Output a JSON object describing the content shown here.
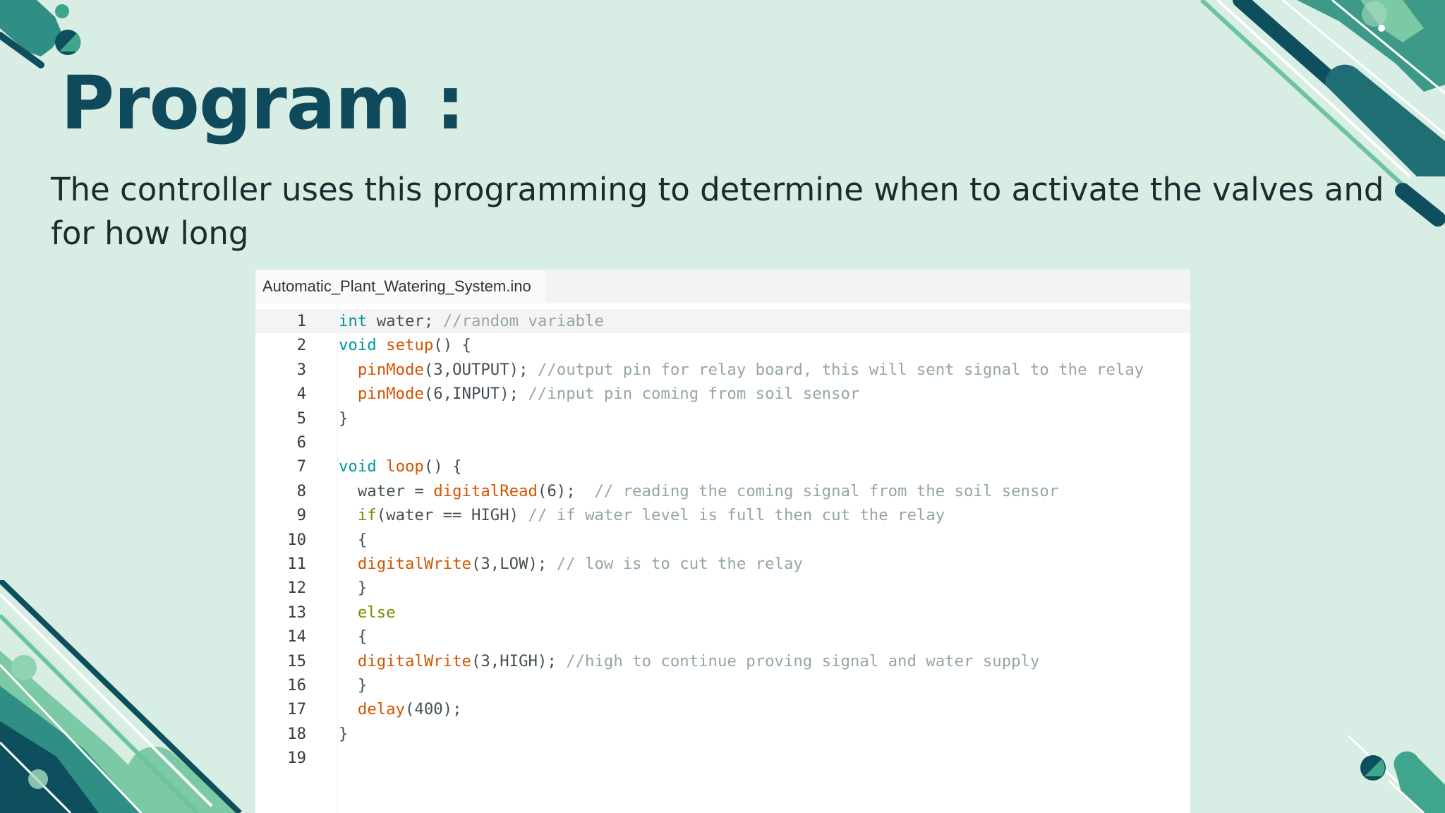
{
  "slide": {
    "title": "Program :",
    "description": "The controller uses this programming to determine when to activate the valves and for how long"
  },
  "colors": {
    "background": "#d8ede4",
    "title": "#0f4a5c",
    "deco_dark": "#0d4f5c",
    "deco_mid": "#2f8f84",
    "deco_light": "#7cc9a6",
    "syntax_type": "#00979c",
    "syntax_function": "#d35400",
    "syntax_keyword": "#728e00",
    "syntax_comment": "#95a5a6"
  },
  "editor": {
    "tab_label": "Automatic_Plant_Watering_System.ino",
    "active_line": 1,
    "lines": [
      {
        "n": "1",
        "tokens": [
          [
            "type",
            "int"
          ],
          [
            "txt",
            " water; "
          ],
          [
            "cmt",
            "//random variable"
          ]
        ]
      },
      {
        "n": "2",
        "tokens": [
          [
            "type",
            "void"
          ],
          [
            "txt",
            " "
          ],
          [
            "fn",
            "setup"
          ],
          [
            "txt",
            "() {"
          ]
        ]
      },
      {
        "n": "3",
        "tokens": [
          [
            "txt",
            "  "
          ],
          [
            "fn",
            "pinMode"
          ],
          [
            "txt",
            "(3,OUTPUT); "
          ],
          [
            "cmt",
            "//output pin for relay board, this will sent signal to the relay"
          ]
        ]
      },
      {
        "n": "4",
        "tokens": [
          [
            "txt",
            "  "
          ],
          [
            "fn",
            "pinMode"
          ],
          [
            "txt",
            "(6,INPUT); "
          ],
          [
            "cmt",
            "//input pin coming from soil sensor"
          ]
        ]
      },
      {
        "n": "5",
        "tokens": [
          [
            "txt",
            "}"
          ]
        ]
      },
      {
        "n": "6",
        "tokens": []
      },
      {
        "n": "7",
        "tokens": [
          [
            "type",
            "void"
          ],
          [
            "txt",
            " "
          ],
          [
            "fn",
            "loop"
          ],
          [
            "txt",
            "() {"
          ]
        ]
      },
      {
        "n": "8",
        "tokens": [
          [
            "txt",
            "  water = "
          ],
          [
            "fn",
            "digitalRead"
          ],
          [
            "txt",
            "(6);  "
          ],
          [
            "cmt",
            "// reading the coming signal from the soil sensor"
          ]
        ]
      },
      {
        "n": "9",
        "tokens": [
          [
            "txt",
            "  "
          ],
          [
            "kw",
            "if"
          ],
          [
            "txt",
            "(water == HIGH) "
          ],
          [
            "cmt",
            "// if water level is full then cut the relay"
          ]
        ]
      },
      {
        "n": "10",
        "tokens": [
          [
            "txt",
            "  {"
          ]
        ]
      },
      {
        "n": "11",
        "tokens": [
          [
            "txt",
            "  "
          ],
          [
            "fn",
            "digitalWrite"
          ],
          [
            "txt",
            "(3,LOW); "
          ],
          [
            "cmt",
            "// low is to cut the relay"
          ]
        ]
      },
      {
        "n": "12",
        "tokens": [
          [
            "txt",
            "  }"
          ]
        ]
      },
      {
        "n": "13",
        "tokens": [
          [
            "txt",
            "  "
          ],
          [
            "kw",
            "else"
          ]
        ]
      },
      {
        "n": "14",
        "tokens": [
          [
            "txt",
            "  {"
          ]
        ]
      },
      {
        "n": "15",
        "tokens": [
          [
            "txt",
            "  "
          ],
          [
            "fn",
            "digitalWrite"
          ],
          [
            "txt",
            "(3,HIGH); "
          ],
          [
            "cmt",
            "//high to continue proving signal and water supply"
          ]
        ]
      },
      {
        "n": "16",
        "tokens": [
          [
            "txt",
            "  }"
          ]
        ]
      },
      {
        "n": "17",
        "tokens": [
          [
            "txt",
            "  "
          ],
          [
            "fn",
            "delay"
          ],
          [
            "txt",
            "(400);"
          ]
        ]
      },
      {
        "n": "18",
        "tokens": [
          [
            "txt",
            "}"
          ]
        ]
      },
      {
        "n": "19",
        "tokens": []
      }
    ]
  }
}
